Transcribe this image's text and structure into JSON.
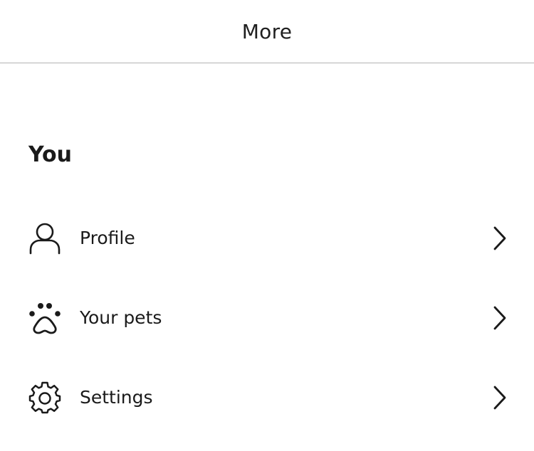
{
  "header": {
    "title": "More"
  },
  "section": {
    "title": "You"
  },
  "menu": {
    "items": [
      {
        "label": "Profile",
        "icon": "person-icon"
      },
      {
        "label": "Your pets",
        "icon": "paw-icon"
      },
      {
        "label": "Settings",
        "icon": "gear-icon"
      }
    ]
  }
}
